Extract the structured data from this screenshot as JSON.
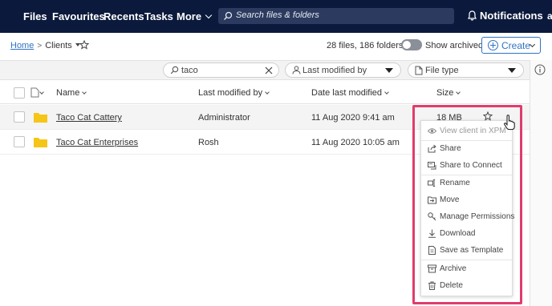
{
  "topnav": {
    "items": [
      "Files",
      "Favourites",
      "Recents",
      "Tasks",
      "More"
    ],
    "search_placeholder": "Search files & folders",
    "notifications_label": "Notifications",
    "user_initial": "a"
  },
  "breadcrumb": {
    "home": "Home",
    "separator": ">",
    "current": "Clients"
  },
  "toolbar": {
    "counts": "28 files, 186 folders",
    "show_archived_label": "Show archived",
    "show_archived_on": false,
    "create_label": "Create"
  },
  "filters": {
    "search_value": "taco",
    "modified_by_placeholder": "Last modified by",
    "file_type_placeholder": "File type"
  },
  "table": {
    "headers": {
      "name": "Name",
      "modified_by": "Last modified by",
      "date_modified": "Date last modified",
      "size": "Size"
    },
    "rows": [
      {
        "name": "Taco Cat Cattery",
        "modified_by": "Administrator",
        "date": "11 Aug 2020 9:41 am",
        "size": "18 MB"
      },
      {
        "name": "Taco Cat Enterprises",
        "modified_by": "Rosh",
        "date": "11 Aug 2020 10:05 am",
        "size": ""
      }
    ]
  },
  "context_menu": {
    "items": [
      {
        "label": "View client in XPM",
        "icon": "eye-icon"
      },
      {
        "label": "Share",
        "icon": "share-icon"
      },
      {
        "label": "Share to Connect",
        "icon": "share-connect-icon"
      },
      {
        "label": "Rename",
        "icon": "rename-icon"
      },
      {
        "label": "Move",
        "icon": "move-icon"
      },
      {
        "label": "Manage Permissions",
        "icon": "key-icon"
      },
      {
        "label": "Download",
        "icon": "download-icon"
      },
      {
        "label": "Save as Template",
        "icon": "template-icon"
      },
      {
        "label": "Archive",
        "icon": "archive-icon"
      },
      {
        "label": "Delete",
        "icon": "trash-icon"
      }
    ]
  },
  "colors": {
    "nav_bg": "#0b1a3c",
    "accent": "#2f73c5",
    "highlight": "#e03c6e",
    "folder": "#f5c518"
  }
}
